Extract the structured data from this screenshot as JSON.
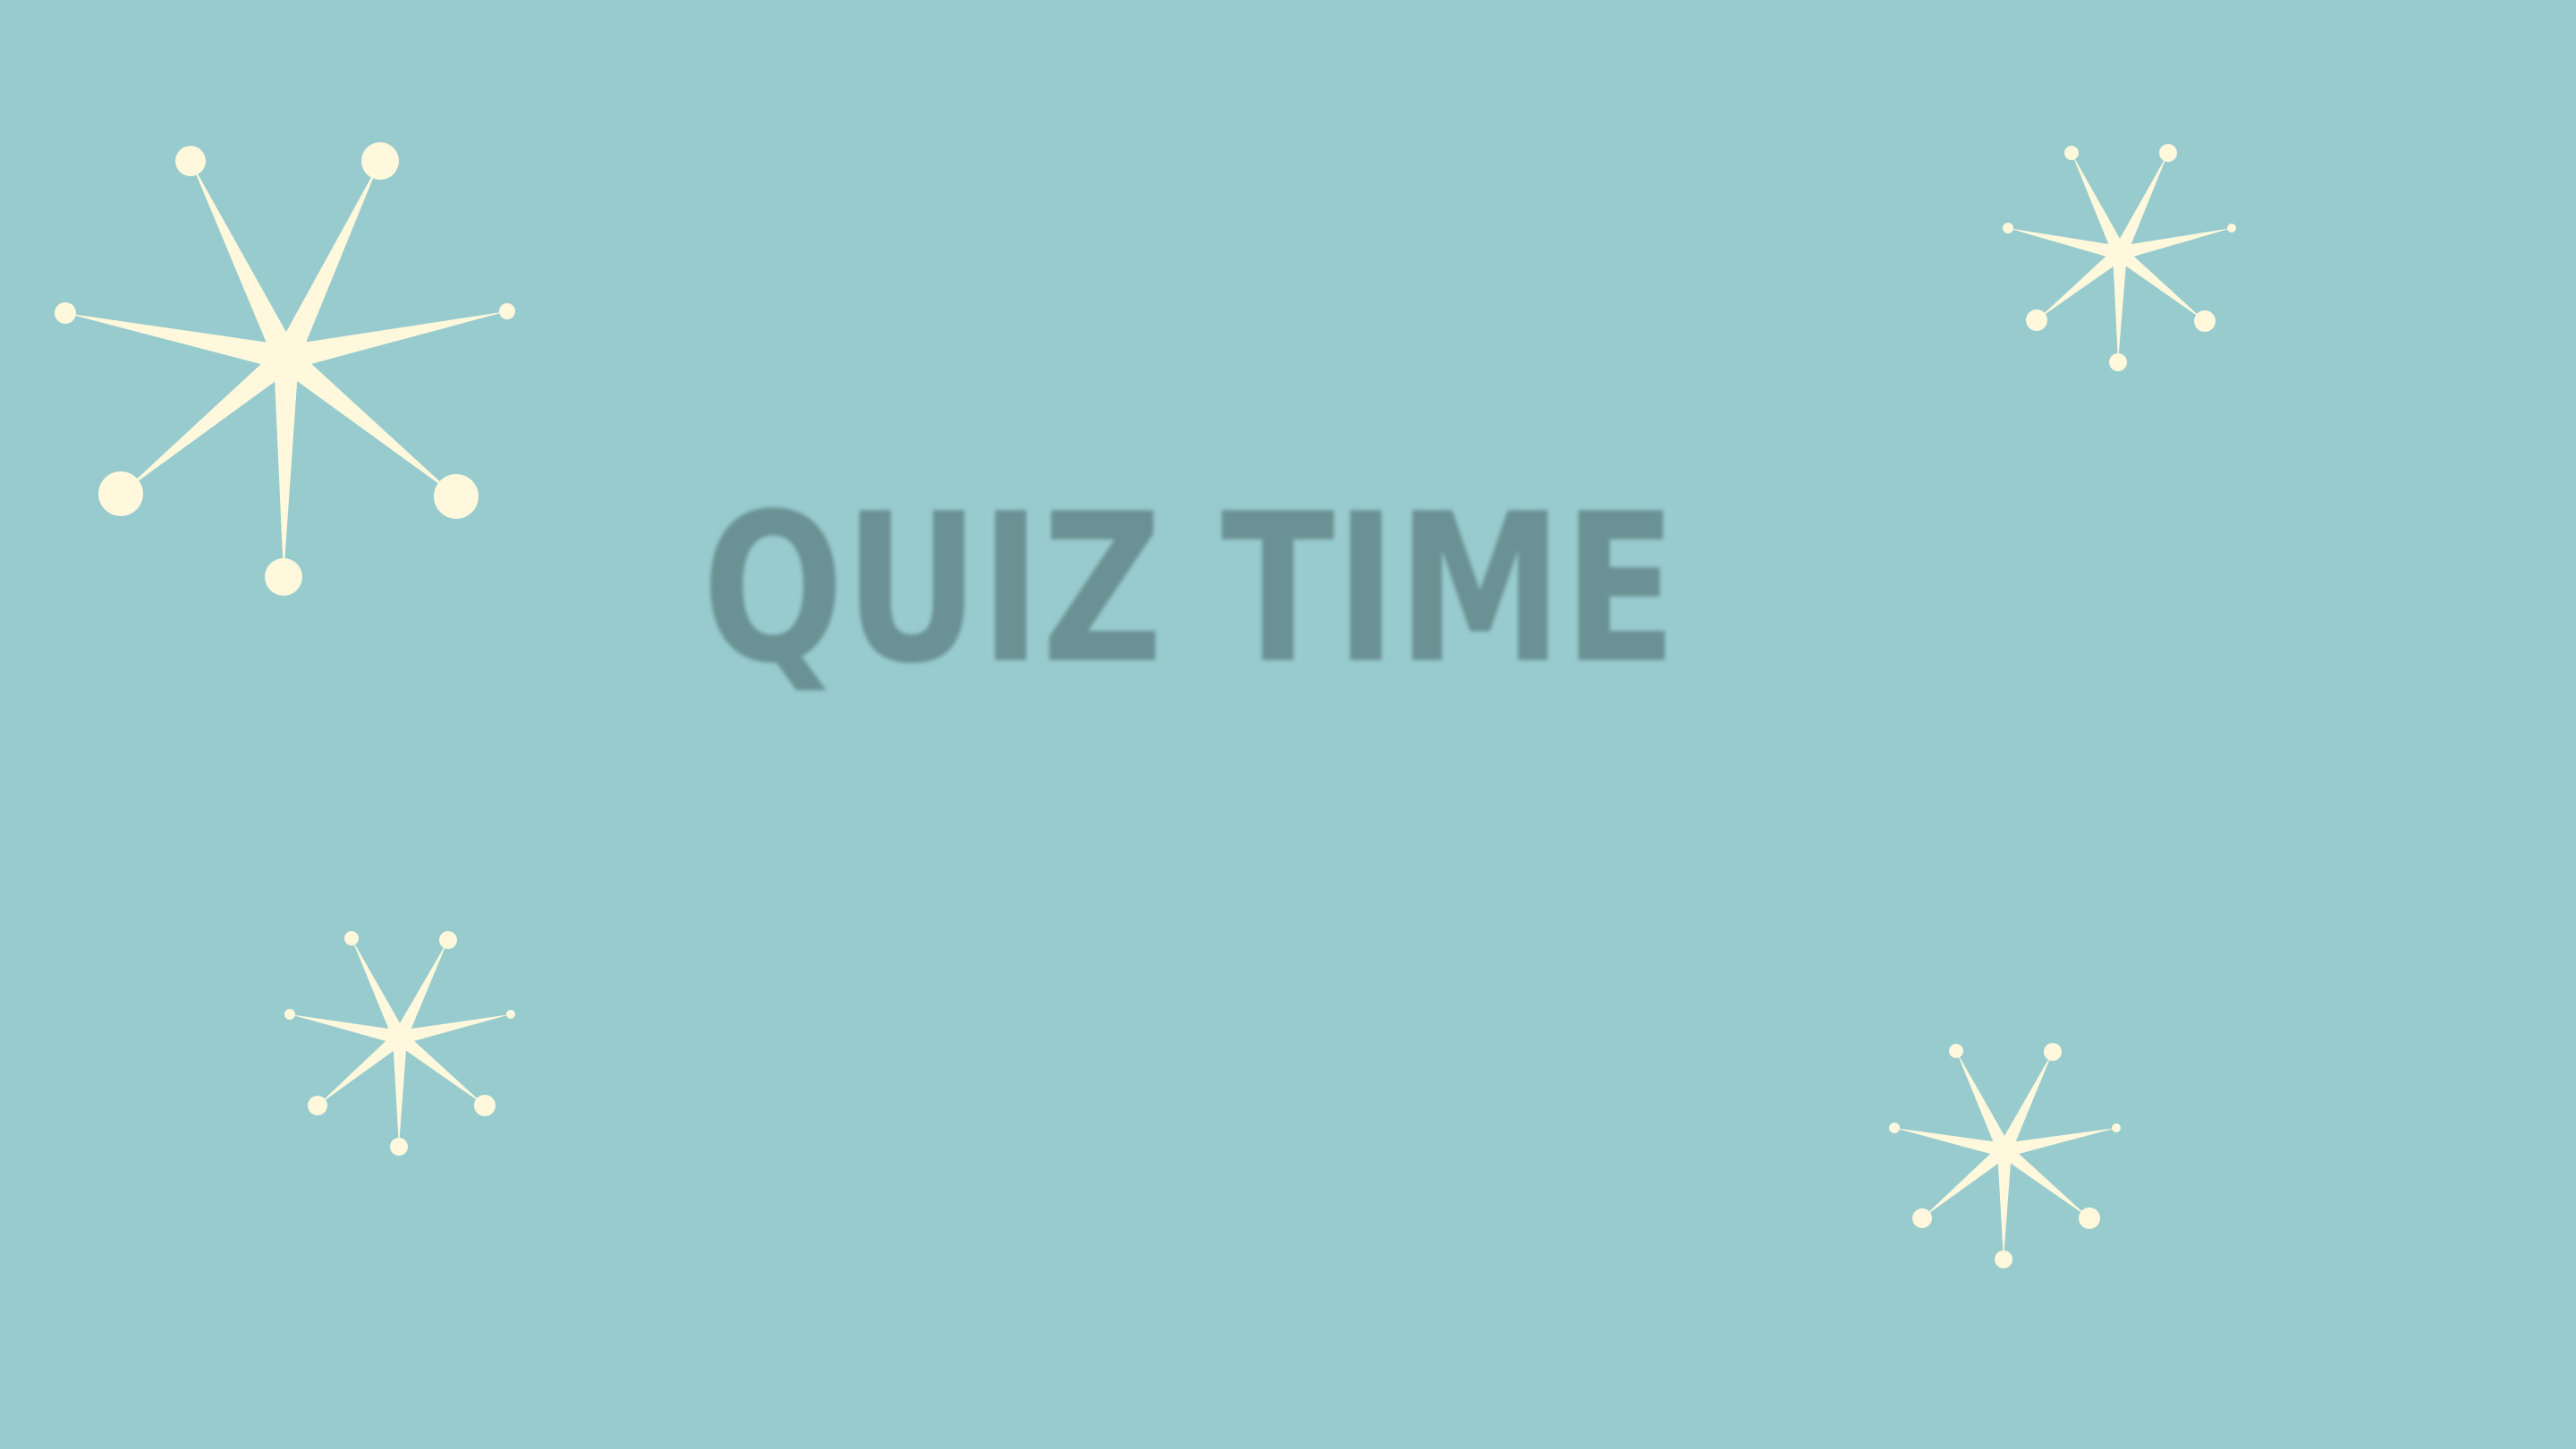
{
  "slide": {
    "title": "QUIZ TIME"
  },
  "theme": {
    "background": "#97cbce",
    "title_color": "#6b9193",
    "star_color": "#fff8dc"
  },
  "decorations": {
    "icon": "atomic-starburst-icon",
    "count": 4
  }
}
